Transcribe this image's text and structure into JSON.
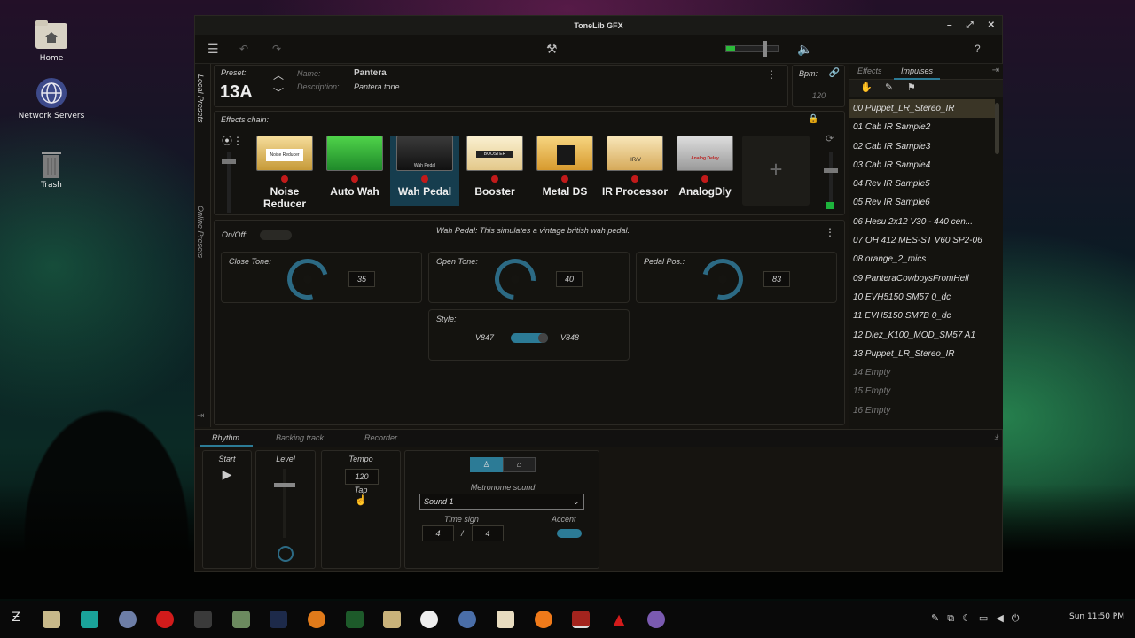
{
  "desktop": {
    "icons": [
      {
        "label": "Home"
      },
      {
        "label": "Network Servers"
      },
      {
        "label": "Trash"
      }
    ]
  },
  "window": {
    "title": "ToneLib GFX"
  },
  "side_tabs": {
    "local": "Local Presets",
    "online": "Online Presets"
  },
  "preset": {
    "label": "Preset:",
    "number": "13A",
    "name_label": "Name:",
    "name": "Pantera",
    "desc_label": "Description:",
    "description": "Pantera tone"
  },
  "bpm": {
    "label": "Bpm:",
    "value": "120"
  },
  "effects_chain": {
    "label": "Effects chain:",
    "pedals": [
      {
        "name": "Noise Reducer",
        "face": "Noise Reducer"
      },
      {
        "name": "Auto Wah",
        "face": ""
      },
      {
        "name": "Wah Pedal",
        "face": "Wah Pedal"
      },
      {
        "name": "Booster",
        "face": "BOOSTER"
      },
      {
        "name": "Metal DS",
        "face": ""
      },
      {
        "name": "IR Processor",
        "face": "IR/V"
      },
      {
        "name": "AnalogDly",
        "face": "Analog Delay"
      }
    ]
  },
  "effect_detail": {
    "onoff_label": "On/Off:",
    "description": "Wah Pedal:  This simulates a vintage british wah pedal.",
    "knobs": [
      {
        "label": "Close Tone:",
        "value": "35"
      },
      {
        "label": "Open Tone:",
        "value": "40"
      },
      {
        "label": "Pedal Pos.:",
        "value": "83"
      }
    ],
    "style": {
      "label": "Style:",
      "left": "V847",
      "right": "V848"
    }
  },
  "right_panel": {
    "tabs": [
      "Effects",
      "Impulses"
    ],
    "impulses": [
      "00 Puppet_LR_Stereo_IR",
      "01 Cab IR Sample2",
      "02 Cab IR Sample3",
      "03 Cab IR Sample4",
      "04 Rev IR Sample5",
      "05 Rev IR Sample6",
      "06 Hesu 2x12 V30 - 440 cen...",
      "07 OH 412 MES-ST V60 SP2-06",
      "08 orange_2_mics",
      "09 PanteraCowboysFromHell",
      "10 EVH5150 SM57 0_dc",
      "11 EVH5150 SM7B 0_dc",
      "12 Diez_K100_MOD_SM57 A1",
      "13 Puppet_LR_Stereo_IR",
      "14 Empty",
      "15 Empty",
      "16 Empty"
    ]
  },
  "bottom": {
    "tabs": [
      "Rhythm",
      "Backing track",
      "Recorder"
    ],
    "start_label": "Start",
    "level_label": "Level",
    "tempo_label": "Tempo",
    "tempo_value": "120",
    "tap_label": "Tap",
    "metronome_label": "Metronome sound",
    "sound": "Sound 1",
    "time_sign_label": "Time sign",
    "ts_num": "4",
    "ts_sep": "/",
    "ts_den": "4",
    "accent_label": "Accent"
  },
  "clock": "Sun 11:50 PM"
}
